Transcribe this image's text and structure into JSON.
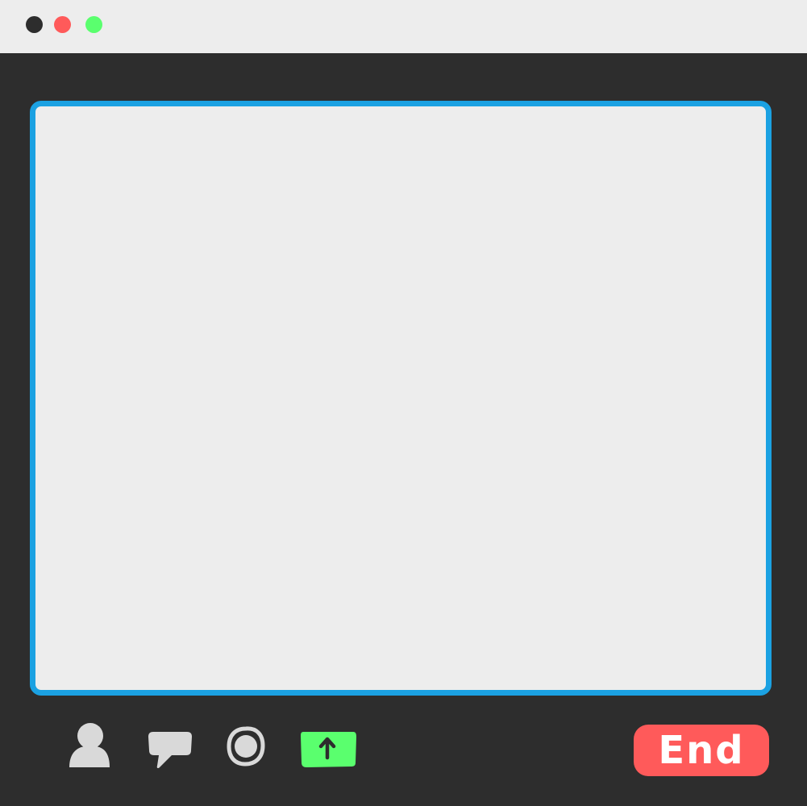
{
  "colors": {
    "window_bg": "#2d2d2d",
    "titlebar_bg": "#ededed",
    "stage_bg": "#ededed",
    "stage_border": "#1ba1e2",
    "icon_gray": "#d9d9d9",
    "close_dot": "#2d2d2d",
    "minimize_dot": "#ff5a5a",
    "maximize_dot": "#5aff6e",
    "share_bg": "#5aff6e",
    "end_bg": "#ff5a5a"
  },
  "titlebar": {
    "buttons": [
      {
        "name": "close-dot",
        "icon": "circle"
      },
      {
        "name": "minimize-dot",
        "icon": "circle"
      },
      {
        "name": "maximize-dot",
        "icon": "circle"
      }
    ]
  },
  "toolbar": {
    "participants_icon": "person-icon",
    "chat_icon": "speech-bubble-icon",
    "record_icon": "record-icon",
    "share_icon": "arrow-up-icon",
    "end_label": "End"
  }
}
